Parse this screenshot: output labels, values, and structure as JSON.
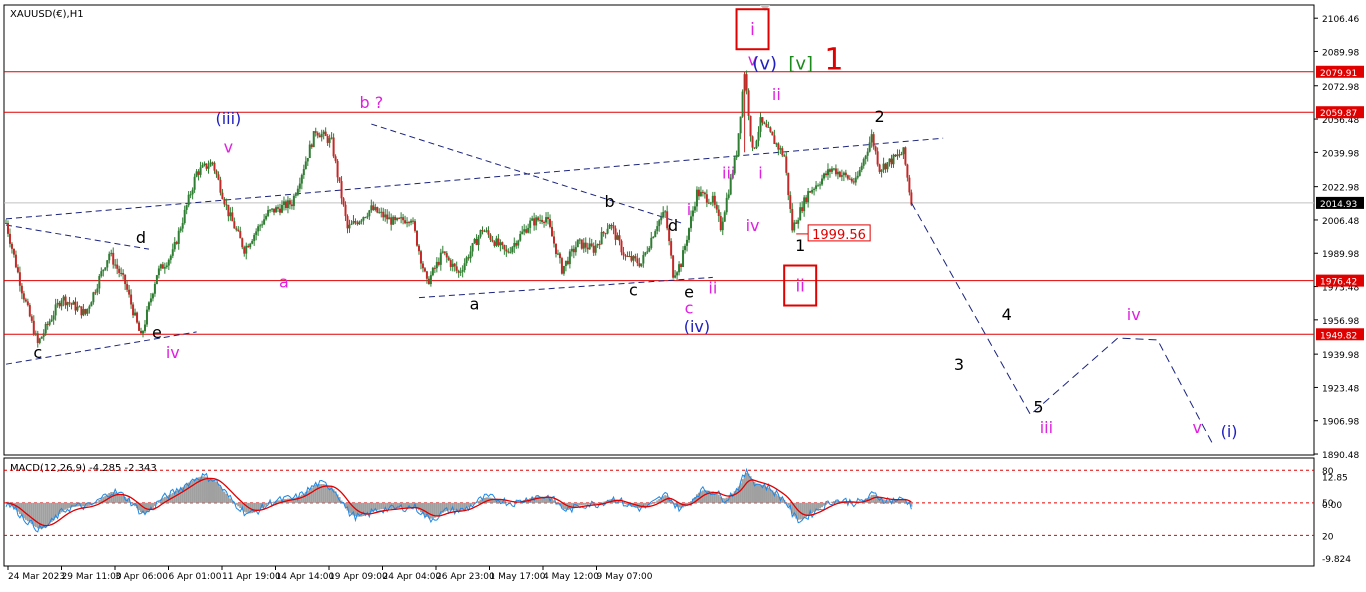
{
  "chart_data": [
    {
      "type": "candlestick",
      "title": "XAUUSD(€),H1",
      "symbol": "XAUUSD(€)",
      "timeframe": "H1",
      "ylim": [
        1890,
        2113
      ],
      "y_ticks": [
        "2106.46",
        "2089.98",
        "2072.98",
        "2056.48",
        "2039.98",
        "2022.98",
        "2006.48",
        "1989.98",
        "1973.48",
        "1956.98",
        "1939.98",
        "1923.48",
        "1906.98",
        "1890.48"
      ],
      "x_ticks": [
        "24 Mar 2023",
        "29 Mar 11:00",
        "3 Apr 06:00",
        "6 Apr 01:00",
        "11 Apr 19:00",
        "14 Apr 14:00",
        "19 Apr 09:00",
        "24 Apr 04:00",
        "26 Apr 23:00",
        "1 May 17:00",
        "4 May 12:00",
        "9 May 07:00"
      ],
      "current_price": {
        "label": "2014.93",
        "value": 2014.93,
        "color": "#000000"
      },
      "horizontal_levels": [
        {
          "label": "2079.91",
          "value": 2079.91
        },
        {
          "label": "2059.87",
          "value": 2059.87
        },
        {
          "label": "1976.42",
          "value": 1976.42
        },
        {
          "label": "1949.82",
          "value": 1949.82
        }
      ],
      "level_color": "#e00000",
      "annotation_low": {
        "label": "1999.56",
        "value": 1999.56
      },
      "price_path": [
        {
          "t": 0,
          "v": 2005
        },
        {
          "t": 2,
          "v": 1972
        },
        {
          "t": 4,
          "v": 1945
        },
        {
          "t": 7,
          "v": 1968
        },
        {
          "t": 10,
          "v": 1960
        },
        {
          "t": 13,
          "v": 1990
        },
        {
          "t": 15,
          "v": 1975
        },
        {
          "t": 17,
          "v": 1948
        },
        {
          "t": 19,
          "v": 1980
        },
        {
          "t": 21,
          "v": 1990
        },
        {
          "t": 24,
          "v": 2030
        },
        {
          "t": 26,
          "v": 2035
        },
        {
          "t": 28,
          "v": 2010
        },
        {
          "t": 30,
          "v": 1992
        },
        {
          "t": 33,
          "v": 2010
        },
        {
          "t": 36,
          "v": 2015
        },
        {
          "t": 39,
          "v": 2051
        },
        {
          "t": 41,
          "v": 2045
        },
        {
          "t": 43,
          "v": 2002
        },
        {
          "t": 46,
          "v": 2012
        },
        {
          "t": 49,
          "v": 2005
        },
        {
          "t": 51,
          "v": 2008
        },
        {
          "t": 53,
          "v": 1975
        },
        {
          "t": 55,
          "v": 1990
        },
        {
          "t": 57,
          "v": 1980
        },
        {
          "t": 60,
          "v": 2002
        },
        {
          "t": 63,
          "v": 1990
        },
        {
          "t": 66,
          "v": 2005
        },
        {
          "t": 68,
          "v": 2008
        },
        {
          "t": 70,
          "v": 1982
        },
        {
          "t": 72,
          "v": 1995
        },
        {
          "t": 74,
          "v": 1992
        },
        {
          "t": 76,
          "v": 2005
        },
        {
          "t": 78,
          "v": 1988
        },
        {
          "t": 80,
          "v": 1985
        },
        {
          "t": 82,
          "v": 2005
        },
        {
          "t": 83,
          "v": 2010
        },
        {
          "t": 84,
          "v": 1980
        },
        {
          "t": 85,
          "v": 1985
        },
        {
          "t": 87,
          "v": 2020
        },
        {
          "t": 89,
          "v": 2016
        },
        {
          "t": 90,
          "v": 2003
        },
        {
          "t": 92,
          "v": 2040
        },
        {
          "t": 93,
          "v": 2080
        },
        {
          "t": 94,
          "v": 2040
        },
        {
          "t": 95,
          "v": 2055
        },
        {
          "t": 96,
          "v": 2050
        },
        {
          "t": 98,
          "v": 2038
        },
        {
          "t": 99,
          "v": 2002
        },
        {
          "t": 101,
          "v": 2020
        },
        {
          "t": 104,
          "v": 2032
        },
        {
          "t": 107,
          "v": 2025
        },
        {
          "t": 109,
          "v": 2048
        },
        {
          "t": 110,
          "v": 2032
        },
        {
          "t": 113,
          "v": 2040
        },
        {
          "t": 114,
          "v": 2015
        }
      ],
      "projection": [
        {
          "t": 114,
          "v": 2015
        },
        {
          "t": 129,
          "v": 1910
        },
        {
          "t": 140,
          "v": 1948
        },
        {
          "t": 145,
          "v": 1947
        },
        {
          "t": 152,
          "v": 1895
        }
      ],
      "trendlines": [
        {
          "from": {
            "t": 0,
            "v": 2007
          },
          "to": {
            "t": 118,
            "v": 2047
          },
          "color": "#1a237e"
        },
        {
          "from": {
            "t": 0,
            "v": 1935
          },
          "to": {
            "t": 24,
            "v": 1951
          },
          "color": "#1a237e"
        },
        {
          "from": {
            "t": 0,
            "v": 2004
          },
          "to": {
            "t": 18,
            "v": 1992
          },
          "color": "#1a237e"
        },
        {
          "from": {
            "t": 46,
            "v": 2054
          },
          "to": {
            "t": 85,
            "v": 2005
          },
          "color": "#1a237e"
        },
        {
          "from": {
            "t": 52,
            "v": 1968
          },
          "to": {
            "t": 89,
            "v": 1978
          },
          "color": "#1a237e"
        }
      ],
      "wave_labels": [
        {
          "text": "c",
          "t": 4,
          "v": 1938,
          "color": "#000000"
        },
        {
          "text": "e",
          "t": 19,
          "v": 1948,
          "color": "#000000"
        },
        {
          "text": "iv",
          "t": 21,
          "v": 1938,
          "color": "#e020e0"
        },
        {
          "text": "d",
          "t": 17,
          "v": 1995,
          "color": "#000000"
        },
        {
          "text": "(iii)",
          "t": 28,
          "v": 2054,
          "color": "#2020c0"
        },
        {
          "text": "v",
          "t": 28,
          "v": 2040,
          "color": "#e020e0"
        },
        {
          "text": "a",
          "t": 35,
          "v": 1973,
          "color": "#e020e0"
        },
        {
          "text": "b ?",
          "t": 46,
          "v": 2062,
          "color": "#e020e0"
        },
        {
          "text": "a",
          "t": 59,
          "v": 1962,
          "color": "#000000"
        },
        {
          "text": "b",
          "t": 76,
          "v": 2013,
          "color": "#000000"
        },
        {
          "text": "c",
          "t": 79,
          "v": 1969,
          "color": "#000000"
        },
        {
          "text": "d",
          "t": 84,
          "v": 2001,
          "color": "#000000"
        },
        {
          "text": "e",
          "t": 86,
          "v": 1968,
          "color": "#000000"
        },
        {
          "text": "c",
          "t": 86,
          "v": 1960,
          "color": "#e020e0"
        },
        {
          "text": "(iv)",
          "t": 87,
          "v": 1951,
          "color": "#2020c0"
        },
        {
          "text": "i",
          "t": 86,
          "v": 2009,
          "color": "#e020e0"
        },
        {
          "text": "ii",
          "t": 89,
          "v": 1970,
          "color": "#e020e0"
        },
        {
          "text": "iii",
          "t": 91,
          "v": 2027,
          "color": "#e020e0"
        },
        {
          "text": "iv",
          "t": 94,
          "v": 2001,
          "color": "#e020e0"
        },
        {
          "text": "i",
          "t": 95,
          "v": 2027,
          "color": "#e020e0"
        },
        {
          "text": "v",
          "t": 94,
          "v": 2083,
          "color": "#e020e0"
        },
        {
          "text": "ii",
          "t": 97,
          "v": 2066,
          "color": "#e020e0"
        },
        {
          "text": "1",
          "t": 100,
          "v": 1991,
          "color": "#000000"
        },
        {
          "text": "2",
          "t": 110,
          "v": 2055,
          "color": "#000000"
        },
        {
          "text": "3",
          "t": 120,
          "v": 1932,
          "color": "#000000"
        },
        {
          "text": "4",
          "t": 126,
          "v": 1957,
          "color": "#000000"
        },
        {
          "text": "5",
          "t": 130,
          "v": 1911,
          "color": "#000000"
        },
        {
          "text": "iii",
          "t": 131,
          "v": 1901,
          "color": "#e020e0"
        },
        {
          "text": "iv",
          "t": 142,
          "v": 1957,
          "color": "#e020e0"
        },
        {
          "text": "v",
          "t": 150,
          "v": 1901,
          "color": "#e020e0"
        },
        {
          "text": "(i)",
          "t": 154,
          "v": 1899,
          "color": "#2020c0"
        }
      ],
      "boxed_labels": [
        {
          "text": "i",
          "t": 94,
          "v": 2100,
          "color": "#e020e0",
          "box_color": "#e00000"
        },
        {
          "text": "ii",
          "t": 100,
          "v": 1973,
          "color": "#e020e0",
          "box_color": "#e00000"
        }
      ],
      "degree_label": {
        "parts": [
          {
            "text": "(v)",
            "color": "#2020c0"
          },
          {
            "text": "[v]",
            "color": "#1a8a1a"
          },
          {
            "text": "1",
            "color": "#e00000"
          }
        ],
        "t": 97,
        "v": 2081
      }
    },
    {
      "type": "line",
      "title": "MACD(12,26,9) -4.285 -2.343",
      "indicator": "MACD",
      "params": "(12,26,9)",
      "macd_value": "-4.285",
      "signal_value": "-2.343",
      "ylim": [
        -31,
        22
      ],
      "y_ticks": [
        "12.85",
        "80",
        "50",
        "0.00",
        "20",
        "-9.824"
      ],
      "reference_lines": [
        16,
        0,
        -16
      ],
      "reference_color": "#e00000",
      "histogram_color": "#a0a0a0",
      "macd_line_color": "#1e88e5",
      "signal_line_color": "#e00000"
    }
  ]
}
